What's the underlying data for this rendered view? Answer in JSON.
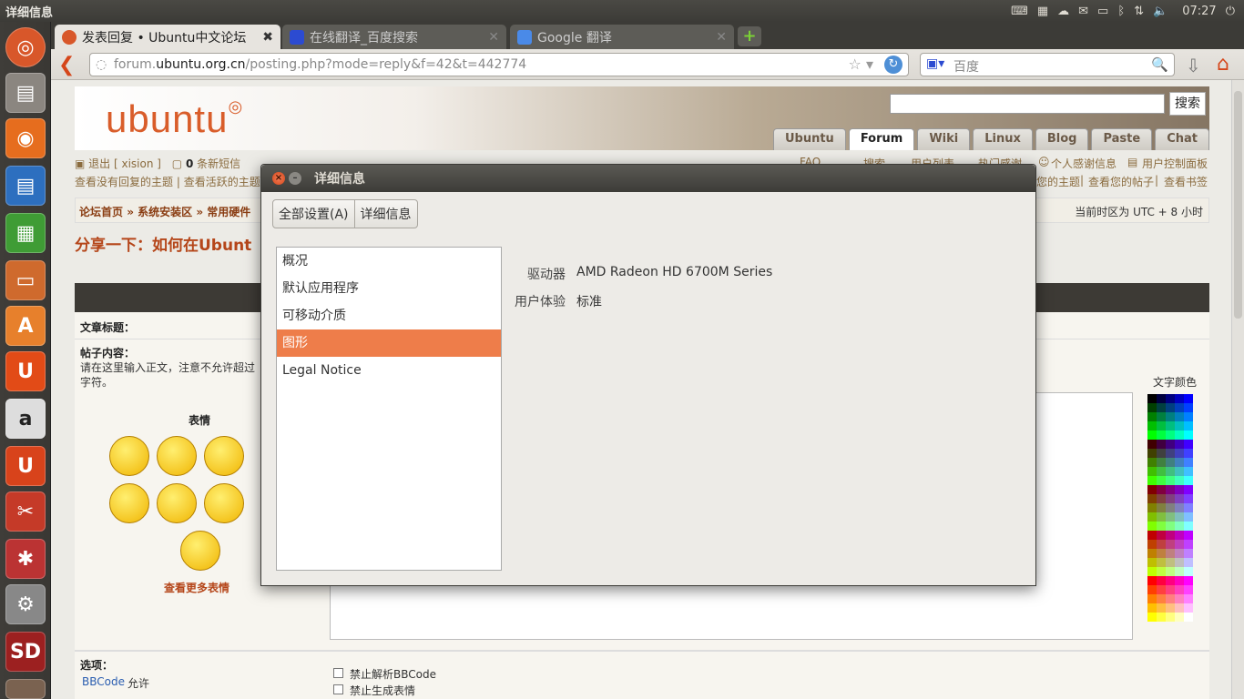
{
  "topbar": {
    "window_title": "详细信息",
    "clock": "07:27"
  },
  "browser": {
    "tabs": [
      {
        "label": "发表回复 • Ubuntu中文论坛",
        "active": true
      },
      {
        "label": "在线翻译_百度搜索",
        "active": false
      },
      {
        "label": "Google 翻译",
        "active": false
      }
    ],
    "url_gray": "forum.",
    "url_domain": "ubuntu.org.cn",
    "url_path": "/posting.php?mode=reply&f=42&t=442774",
    "search_placeholder": "百度"
  },
  "site": {
    "logo": "ubuntu",
    "search_button": "搜索",
    "nav_tabs": [
      "Ubuntu",
      "Forum",
      "Wiki",
      "Linux",
      "Blog",
      "Paste",
      "Chat"
    ],
    "active_nav": "Forum",
    "logout": "退出 [ xision ]",
    "messages_count": "0",
    "messages_label": "条新短信",
    "faq": "FAQ",
    "search_link": "搜索",
    "members": "用户列表",
    "thanks_hot": "热门感谢",
    "thanks_personal": "个人感谢信息",
    "ucp": "用户控制面板",
    "unanswered": "查看没有回复的主题",
    "active_topics": "查看活跃的主题",
    "your_topics": "您的主题",
    "your_posts": "查看您的帖子",
    "bookmarks": "查看书签",
    "breadcrumb": [
      "论坛首页",
      "系统安装区",
      "常用硬件"
    ],
    "timezone": "当前时区为 UTC + 8 小时",
    "page_title": "分享一下：如何在Ubunt",
    "subject_label": "文章标题：",
    "body_label": "帖子内容：",
    "body_hint": "请在这里输入正文，注意不允许超过",
    "body_hint2": "字符。",
    "smilies_label": "表情",
    "more_smilies": "查看更多表情",
    "text_color_label": "文字颜色",
    "options_label": "选项：",
    "bbcode": "BBCode",
    "bbcode_allowed": "允许",
    "disable_bbcode": "禁止解析BBCode",
    "disable_smilies": "禁止生成表情"
  },
  "dialog": {
    "title": "详细信息",
    "buttons": [
      "全部设置(A)",
      "详细信息"
    ],
    "sidebar": [
      {
        "label": "概况",
        "selected": false
      },
      {
        "label": "默认应用程序",
        "selected": false
      },
      {
        "label": "可移动介质",
        "selected": false
      },
      {
        "label": "图形",
        "selected": true
      },
      {
        "label": "Legal Notice",
        "selected": false
      }
    ],
    "details": [
      {
        "key": "驱动器",
        "value": "AMD Radeon HD 6700M Series"
      },
      {
        "key": "用户体验",
        "value": "标准"
      }
    ]
  },
  "colors": {
    "accent": "#ee7d4a",
    "panel": "#3c3b37"
  }
}
